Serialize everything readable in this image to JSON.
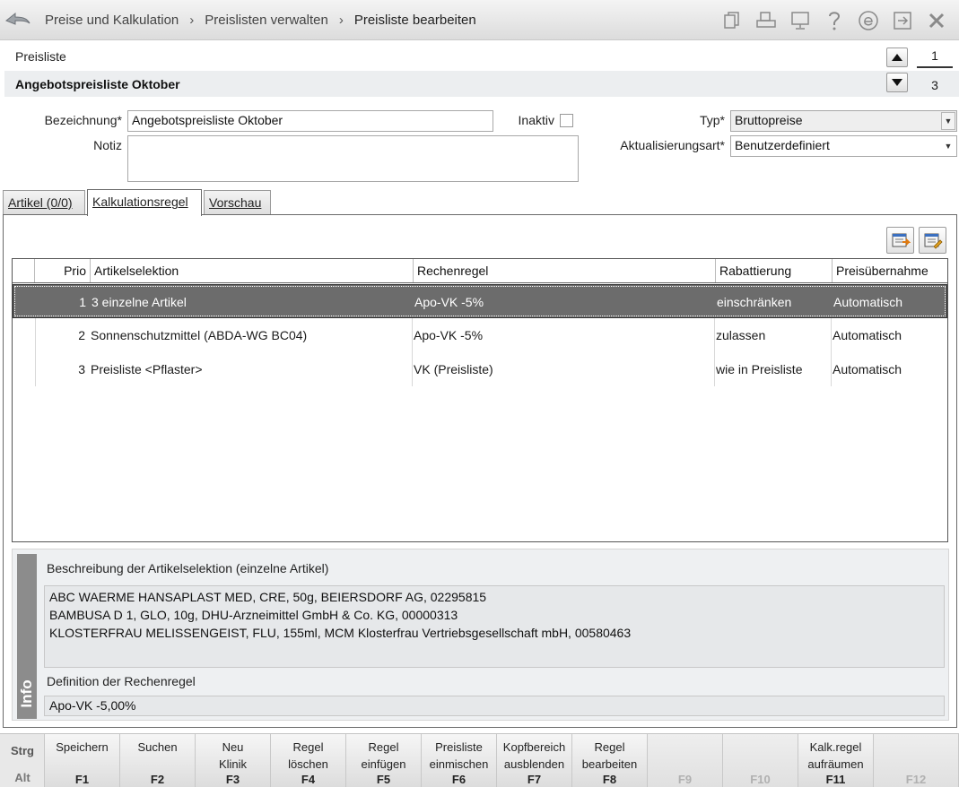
{
  "header": {
    "breadcrumbs": [
      "Preise und Kalkulation",
      "Preislisten verwalten",
      "Preisliste bearbeiten"
    ],
    "separator": "›",
    "toolbar_icons": [
      "copy-icon",
      "print-icon",
      "monitor-icon",
      "help-icon",
      "e-icon",
      "export-icon",
      "close-icon"
    ]
  },
  "pricelist": {
    "section_label": "Preisliste",
    "title": "Angebotspreisliste Oktober",
    "page_current": "1",
    "page_total": "3"
  },
  "form": {
    "bezeichnung_label": "Bezeichnung*",
    "bezeichnung_value": "Angebotspreisliste Oktober",
    "inaktiv_label": "Inaktiv",
    "inaktiv_checked": false,
    "notiz_label": "Notiz",
    "notiz_value": "",
    "typ_label": "Typ*",
    "typ_value": "Bruttopreise",
    "aktualisierungsart_label": "Aktualisierungsart*",
    "aktualisierungsart_value": "Benutzerdefiniert"
  },
  "tabs": [
    {
      "label": "Artikel (0/0)",
      "active": false
    },
    {
      "label": "Kalkulationsregel",
      "active": true
    },
    {
      "label": "Vorschau",
      "active": false
    }
  ],
  "table": {
    "columns": [
      "",
      "Prio",
      "Artikelselektion",
      "Rechenregel",
      "Rabattierung",
      "Preisübernahme"
    ],
    "rows": [
      {
        "prio": "1",
        "artikelselektion": "3 einzelne Artikel",
        "rechenregel": "Apo-VK -5%",
        "rabattierung": "einschränken",
        "preisuebernahme": "Automatisch",
        "selected": true
      },
      {
        "prio": "2",
        "artikelselektion": "Sonnenschutzmittel (ABDA-WG BC04)",
        "rechenregel": "Apo-VK -5%",
        "rabattierung": "zulassen",
        "preisuebernahme": "Automatisch",
        "selected": false
      },
      {
        "prio": "3",
        "artikelselektion": "Preisliste <Pflaster>",
        "rechenregel": "VK (Preisliste)",
        "rabattierung": "wie in Preisliste",
        "preisuebernahme": "Automatisch",
        "selected": false
      }
    ]
  },
  "info": {
    "strip_label": "Info",
    "selection_heading": "Beschreibung der Artikelselektion (einzelne Artikel)",
    "selection_items": [
      "ABC WAERME HANSAPLAST MED, CRE, 50g, BEIERSDORF AG, 02295815",
      "BAMBUSA D 1, GLO, 10g, DHU-Arzneimittel GmbH & Co. KG, 00000313",
      "KLOSTERFRAU MELISSENGEIST, FLU, 155ml, MCM Klosterfrau Vertriebsgesellschaft mbH, 00580463"
    ],
    "rule_heading": "Definition der Rechenregel",
    "rule_value": "Apo-VK -5,00%"
  },
  "fkeys": {
    "modifier_top": "Strg",
    "modifier_bottom": "Alt",
    "keys": [
      {
        "label": "Speichern",
        "key": "F1",
        "enabled": true
      },
      {
        "label": "Suchen",
        "key": "F2",
        "enabled": true
      },
      {
        "label": "Neu\nKlinik",
        "key": "F3",
        "enabled": true
      },
      {
        "label": "Regel\nlöschen",
        "key": "F4",
        "enabled": true
      },
      {
        "label": "Regel\neinfügen",
        "key": "F5",
        "enabled": true
      },
      {
        "label": "Preisliste\neinmischen",
        "key": "F6",
        "enabled": true
      },
      {
        "label": "Kopfbereich\nausblenden",
        "key": "F7",
        "enabled": true
      },
      {
        "label": "Regel\nbearbeiten",
        "key": "F8",
        "enabled": true
      },
      {
        "label": "",
        "key": "F9",
        "enabled": false
      },
      {
        "label": "",
        "key": "F10",
        "enabled": false
      },
      {
        "label": "Kalk.regel\naufräumen",
        "key": "F11",
        "enabled": true
      },
      {
        "label": "",
        "key": "F12",
        "enabled": false
      }
    ]
  }
}
